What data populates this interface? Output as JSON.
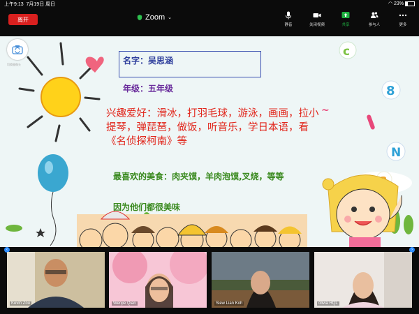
{
  "status_bar": {
    "time": "上午9:13",
    "date": "7月19日 周日",
    "battery": "23%"
  },
  "toolbar": {
    "leave_label": "离开",
    "app_title": "Zoom",
    "buttons": [
      {
        "label": "静音",
        "icon": "microphone-icon"
      },
      {
        "label": "关闭视频",
        "icon": "video-camera-icon"
      },
      {
        "label": "共享",
        "icon": "share-screen-icon"
      },
      {
        "label": "参与人",
        "icon": "participants-icon"
      },
      {
        "label": "更多",
        "icon": "more-icon"
      }
    ],
    "accent": "#0e71eb",
    "share_color": "#1fb141",
    "leave_color": "#d9201f"
  },
  "slide": {
    "switch_camera_label": "切换摄像头",
    "name": "名字：吴思涵",
    "grade": "年级：五年级",
    "hobbies": "兴趣爱好：滑冰，打羽毛球，游泳，画画，拉小提琴，弹琵琶，做饭，听音乐，学日本语，看《名侦探柯南》等",
    "food": "最喜欢的美食：肉夹馍，羊肉泡馍,叉烧，等等",
    "because": "因为他们都很美味"
  },
  "participants": [
    {
      "name": "Kevin Zou"
    },
    {
      "name": "Wenjie Qian"
    },
    {
      "name": "Siew Lian Koh"
    },
    {
      "name": "olivia HQL"
    }
  ]
}
